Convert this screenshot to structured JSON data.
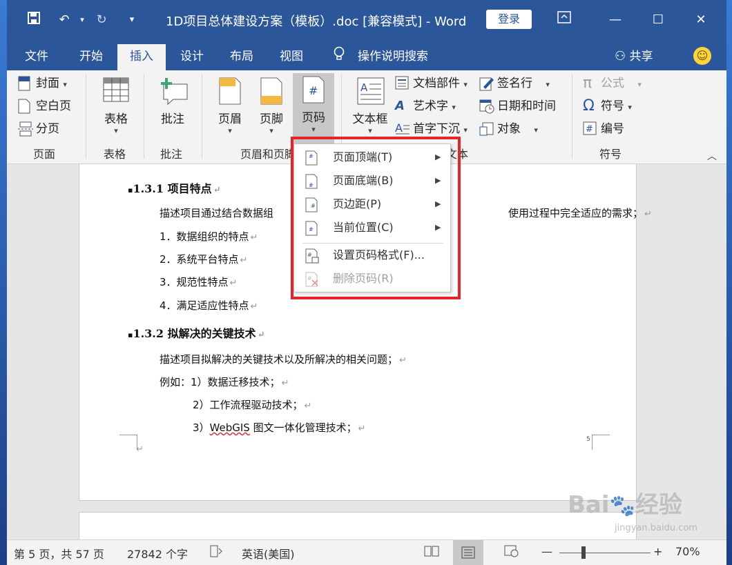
{
  "titlebar": {
    "title": "1D项目总体建设方案（模板）.doc [兼容模式]  -  Word",
    "login": "登录"
  },
  "tabs": [
    "文件",
    "开始",
    "插入",
    "设计",
    "布局",
    "视图"
  ],
  "active_tab": "插入",
  "tell_me": "操作说明搜索",
  "share": "共享",
  "ribbon": {
    "page_group": {
      "label": "页面",
      "cover": "封面",
      "blank_page": "空白页",
      "page_break": "分页"
    },
    "table_group": {
      "label": "表格",
      "table": "表格"
    },
    "comment_group": {
      "label": "批注",
      "comment": "批注"
    },
    "header_footer_group": {
      "label": "页眉和页脚",
      "header": "页眉",
      "footer": "页脚",
      "page_number": "页码"
    },
    "text_group": {
      "label": "文本",
      "text_box": "文本框",
      "quick_parts": "文档部件",
      "wordart": "艺术字",
      "drop_cap": "首字下沉",
      "signature_line": "签名行",
      "date_time": "日期和时间",
      "object": "对象"
    },
    "symbols_group": {
      "label": "符号",
      "equation": "公式",
      "symbol": "符号",
      "number": "编号"
    }
  },
  "menu": {
    "items": [
      {
        "label": "页面顶端(T)",
        "has_submenu": true,
        "enabled": true
      },
      {
        "label": "页面底端(B)",
        "has_submenu": true,
        "enabled": true
      },
      {
        "label": "页边距(P)",
        "has_submenu": true,
        "enabled": true
      },
      {
        "label": "当前位置(C)",
        "has_submenu": true,
        "enabled": true
      },
      {
        "label": "设置页码格式(F)...",
        "has_submenu": false,
        "enabled": true
      },
      {
        "label": "删除页码(R)",
        "has_submenu": false,
        "enabled": false
      }
    ],
    "highlight_color": "#e8242a"
  },
  "document": {
    "heading1": "1.3.1  项目特点",
    "para1_left": "描述项目通过结合数据组",
    "para1_right": "使用过程中完全适应的需求；",
    "list1": [
      "1．数据组织的特点",
      "2．系统平台特点",
      "3．规范性特点",
      "4．满足适应性特点"
    ],
    "heading2": "1.3.2  拟解决的关键技术",
    "para2": "描述项目拟解决的关键技术以及所解决的相关问题；",
    "example_prefix": "例如：",
    "examples": [
      "1）数据迁移技术；",
      "2）工作流程驱动技术；",
      "3）"
    ],
    "webgis": "WebGIS",
    "example3_rest": " 图文一体化管理技术；",
    "page_number_mark": "5",
    "para_mark": "↵"
  },
  "statusbar": {
    "page_info": "第 5 页，共 57 页",
    "word_count": "27842 个字",
    "language": "英语(美国)",
    "zoom": "70%"
  },
  "watermark": {
    "brand": "Bai",
    "brand2": "经验",
    "url": "jingyan.baidu.com"
  },
  "colors": {
    "word_blue": "#2b579a",
    "accent": "#2b579a"
  }
}
